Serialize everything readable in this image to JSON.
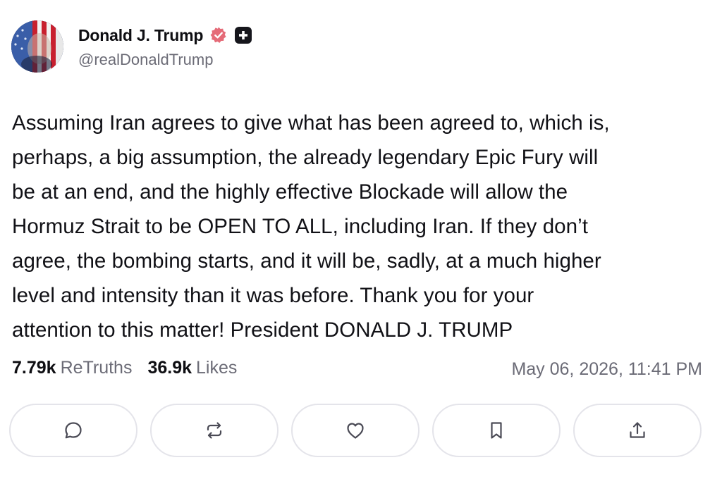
{
  "author": {
    "display_name": "Donald J. Trump",
    "handle": "@realDonaldTrump",
    "avatar_icon": "profile-photo",
    "verified_icon": "verified-badge-icon",
    "verified_color": "#e35e6a"
  },
  "post": {
    "lines": [
      "Assuming Iran agrees to give what has been agreed to, which is,",
      "perhaps, a big assumption, the already legendary Epic Fury will",
      "be at an end, and the highly effective Blockade will allow the",
      "Hormuz Strait to be OPEN TO ALL, including Iran. If they don’t",
      "agree, the bombing starts, and it will be, sadly, at a much higher",
      "level and intensity than it was before. Thank you for your",
      "attention to this matter! President DONALD J. TRUMP"
    ]
  },
  "stats": {
    "retruths_count": "7.79k",
    "retruths_label": "ReTruths",
    "likes_count": "36.9k",
    "likes_label": "Likes",
    "timestamp": "May 06, 2026, 11:41 PM"
  },
  "actions": [
    {
      "name": "reply",
      "icon": "comment-bubble-icon"
    },
    {
      "name": "retruth",
      "icon": "repost-arrows-icon"
    },
    {
      "name": "like",
      "icon": "heart-icon"
    },
    {
      "name": "bookmark",
      "icon": "bookmark-icon"
    },
    {
      "name": "share",
      "icon": "share-upload-icon"
    }
  ]
}
